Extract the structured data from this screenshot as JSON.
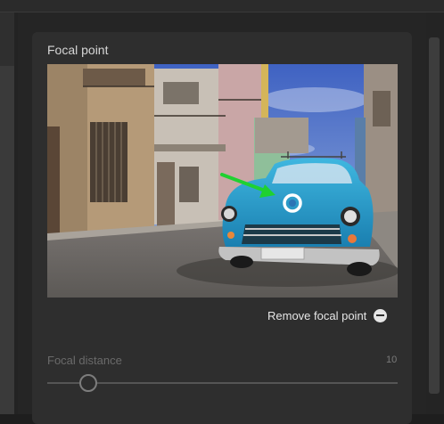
{
  "panel": {
    "title": "Focal point"
  },
  "photo": {
    "subject": "blue-vintage-car-street-scene",
    "focal_marker_icon": "ring-marker-icon",
    "arrow_icon": "green-arrow-icon",
    "arrow_color": "#1fd131"
  },
  "actions": {
    "remove_label": "Remove focal point",
    "remove_icon": "minus-circle-icon"
  },
  "focal_distance": {
    "label": "Focal distance",
    "value": "10",
    "slider_fraction": 0.1
  },
  "colors": {
    "panel_bg": "#2e2e2e",
    "text": "#d6d6d6",
    "disabled_text": "#6a6a6a"
  }
}
